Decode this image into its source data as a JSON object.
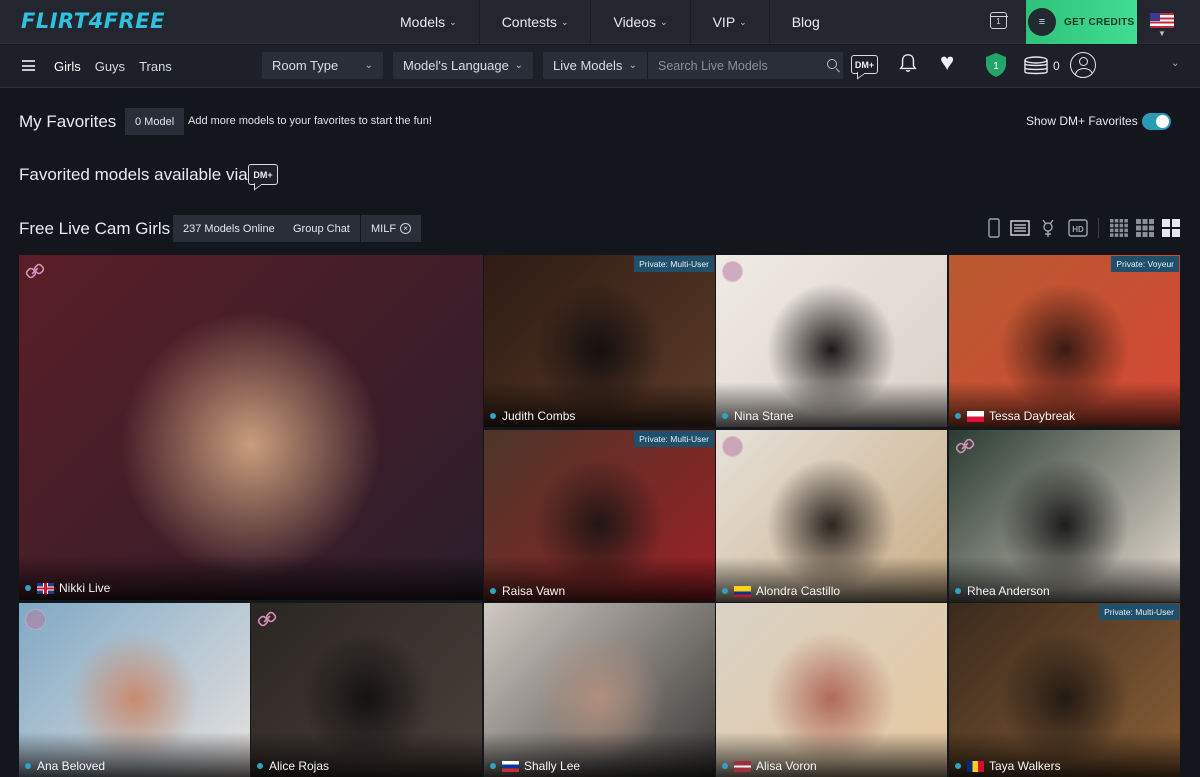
{
  "brand": {
    "logo": "FLIRT4FREE"
  },
  "topnav": [
    {
      "label": "Models",
      "has_caret": true
    },
    {
      "label": "Contests",
      "has_caret": true
    },
    {
      "label": "Videos",
      "has_caret": true
    },
    {
      "label": "VIP",
      "has_caret": true
    },
    {
      "label": "Blog",
      "has_caret": false
    }
  ],
  "calendar_day": "1",
  "credits_button": "GET CREDITS",
  "gender_tabs": [
    "Girls",
    "Guys",
    "Trans"
  ],
  "filters": {
    "room_type": "Room Type",
    "language": "Model's Language",
    "live_models": "Live Models",
    "search_placeholder": "Search Live Models"
  },
  "dm_label": "DM+",
  "shield_level": "1",
  "coins": "0",
  "favorites": {
    "title": "My Favorites",
    "count_chip": "0 Model",
    "hint": "Add more models to your favorites to start the fun!",
    "toggle_label": "Show DM+ Favorites",
    "toggle_on": true,
    "via_title": "Favorited models available via"
  },
  "section": {
    "title": "Free Live Cam Girls",
    "chips": [
      "237 Models Online",
      "Group Chat",
      "MILF"
    ]
  },
  "models": [
    {
      "name": "Nikki Live",
      "flag": "uk",
      "badge": "",
      "dm": "link",
      "colors": [
        "#5a1e28",
        "#2a1d2a",
        "#c99e7c"
      ]
    },
    {
      "name": "Judith Combs",
      "flag": "",
      "badge": "Private: Multi-User",
      "dm": "",
      "colors": [
        "#2d1b14",
        "#5c3b27",
        "#141010"
      ]
    },
    {
      "name": "Nina Stane",
      "flag": "",
      "badge": "",
      "dm": "circle",
      "colors": [
        "#efeae4",
        "#d9d1c8",
        "#1e1a1a"
      ]
    },
    {
      "name": "Tessa Daybreak",
      "flag": "pl",
      "badge": "Private: Voyeur",
      "dm": "",
      "colors": [
        "#b85a30",
        "#d54735",
        "#3a1b14"
      ]
    },
    {
      "name": "Raisa Vawn",
      "flag": "",
      "badge": "Private: Multi-User",
      "dm": "",
      "colors": [
        "#4b3628",
        "#9b1f25",
        "#201614"
      ]
    },
    {
      "name": "Alondra Castillo",
      "flag": "co",
      "badge": "",
      "dm": "circle",
      "colors": [
        "#e6e1da",
        "#c9ad85",
        "#2b2420"
      ]
    },
    {
      "name": "Rhea Anderson",
      "flag": "",
      "badge": "",
      "dm": "link",
      "colors": [
        "#2a3b32",
        "#e7ddd2",
        "#1c1c1c"
      ]
    },
    {
      "name": "Ana Beloved",
      "flag": "",
      "badge": "",
      "dm": "circle",
      "colors": [
        "#7fa9c6",
        "#e8e2de",
        "#c98b70"
      ]
    },
    {
      "name": "Alice Rojas",
      "flag": "",
      "badge": "",
      "dm": "link",
      "colors": [
        "#2b2623",
        "#4a403a",
        "#141212"
      ]
    },
    {
      "name": "Shally Lee",
      "flag": "ru",
      "badge": "",
      "dm": "",
      "colors": [
        "#cfc9c2",
        "#3a3836",
        "#b08f7d"
      ]
    },
    {
      "name": "Alisa Voron",
      "flag": "lv",
      "badge": "",
      "dm": "",
      "colors": [
        "#d9d2c6",
        "#e6c9a0",
        "#b06a5a"
      ]
    },
    {
      "name": "Taya Walkers",
      "flag": "ro",
      "badge": "Private: Multi-User",
      "dm": "",
      "colors": [
        "#3a2a1c",
        "#8a5f36",
        "#231a14"
      ]
    }
  ]
}
